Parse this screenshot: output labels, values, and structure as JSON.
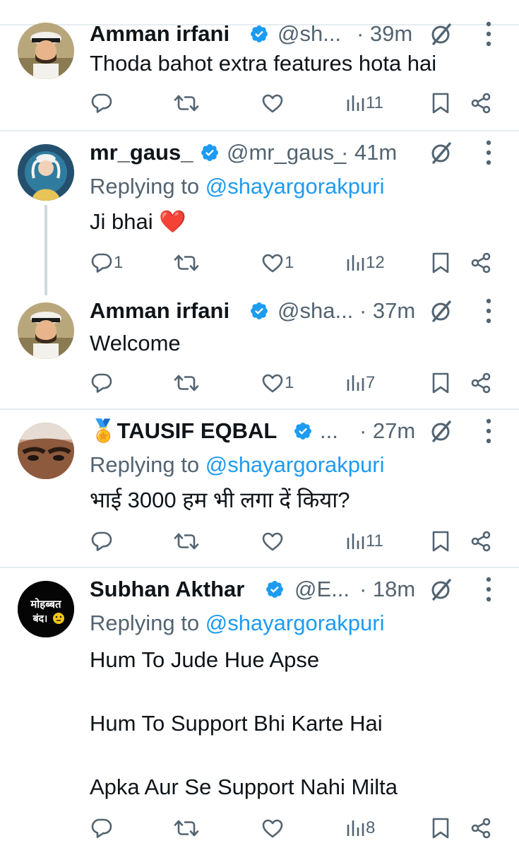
{
  "tweets": [
    {
      "name": "Amman irfani",
      "handle": "@sh...",
      "time": "· 39m",
      "replying_prefix": "",
      "replying_to": "",
      "text": [
        "Thoda bahot extra features hota hai"
      ],
      "counts": {
        "reply": "",
        "retweet": "",
        "like": "",
        "views": "11"
      }
    },
    {
      "name": "mr_gaus_",
      "handle": "@mr_gaus_",
      "time": "· 41m",
      "replying_prefix": "Replying to ",
      "replying_to": "@shayargorakpuri",
      "text": [
        "Ji bhai ❤️"
      ],
      "counts": {
        "reply": "1",
        "retweet": "",
        "like": "1",
        "views": "12"
      }
    },
    {
      "name": "Amman irfani",
      "handle": "@sha...",
      "time": "· 37m",
      "replying_prefix": "",
      "replying_to": "",
      "text": [
        "Welcome"
      ],
      "counts": {
        "reply": "",
        "retweet": "",
        "like": "1",
        "views": "7"
      }
    },
    {
      "name": "🏅TAUSIF EQBAL",
      "handle": "...",
      "time": "· 27m",
      "replying_prefix": "Replying to ",
      "replying_to": "@shayargorakpuri",
      "text": [
        "भाई 3000 हम भी लगा दें किया?"
      ],
      "counts": {
        "reply": "",
        "retweet": "",
        "like": "",
        "views": "11"
      }
    },
    {
      "name": "Subhan Akthar",
      "handle": "@E...",
      "time": "· 18m",
      "replying_prefix": "Replying to ",
      "replying_to": "@shayargorakpuri",
      "text": [
        "Hum To Jude Hue Apse",
        "Hum To Support Bhi Karte Hai",
        "Apka Aur Se Support Nahi Milta"
      ],
      "counts": {
        "reply": "",
        "retweet": "",
        "like": "",
        "views": "8"
      },
      "avatar_text": [
        "मोहब्बत",
        "बंद।"
      ]
    }
  ],
  "icons": {
    "verified": "verified-badge-icon",
    "grok": "grok-icon",
    "more": "more-vertical-icon",
    "reply": "reply-icon",
    "retweet": "retweet-icon",
    "like": "like-icon",
    "views": "views-icon",
    "bookmark": "bookmark-icon",
    "share": "share-icon"
  },
  "colors": {
    "link": "#1d9bf0",
    "secondary": "#536471",
    "primary": "#0f1419",
    "divider": "#e6ecf0",
    "heart": "#f01e2c"
  }
}
